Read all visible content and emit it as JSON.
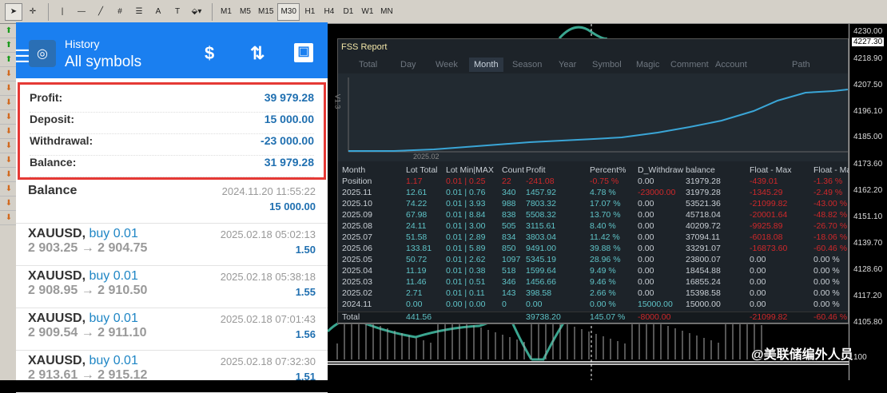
{
  "toolbar": {
    "timeframes": [
      "M1",
      "M5",
      "M15",
      "M30",
      "H1",
      "H4",
      "D1",
      "W1",
      "MN"
    ],
    "active": "M30",
    "tools": [
      "A"
    ]
  },
  "mobile": {
    "title": "History",
    "subtitle": "All symbols",
    "menu_icon": "☰",
    "icons": [
      "deposit-swap-icon",
      "sort-icon",
      "calendar-icon"
    ],
    "summary": [
      {
        "label": "Profit:",
        "value": "39 979.28"
      },
      {
        "label": "Deposit:",
        "value": "15 000.00"
      },
      {
        "label": "Withdrawal:",
        "value": "-23 000.00"
      },
      {
        "label": "Balance:",
        "value": "31 979.28"
      }
    ],
    "balance_item": {
      "title": "Balance",
      "date": "2024.11.20 11:55:22",
      "value": "15 000.00"
    },
    "trades": [
      {
        "symbol": "XAUUSD,",
        "side": "buy 0.01",
        "prices": "2 903.25 → 2 904.75",
        "date": "2025.02.18 05:02:13",
        "profit": "1.50"
      },
      {
        "symbol": "XAUUSD,",
        "side": "buy 0.01",
        "prices": "2 908.95 → 2 910.50",
        "date": "2025.02.18 05:38:18",
        "profit": "1.55"
      },
      {
        "symbol": "XAUUSD,",
        "side": "buy 0.01",
        "prices": "2 909.54 → 2 911.10",
        "date": "2025.02.18 07:01:43",
        "profit": "1.56"
      },
      {
        "symbol": "XAUUSD,",
        "side": "buy 0.01",
        "prices": "2 913.61 → 2 915.12",
        "date": "2025.02.18 07:32:30",
        "profit": "1.51"
      }
    ]
  },
  "report": {
    "title": "FSS Report",
    "tabs": [
      "Total",
      "Day",
      "Week",
      "Month",
      "Season",
      "Year",
      "Symbol",
      "Magic",
      "Comment",
      "Account",
      "Path"
    ],
    "active_tab": "Month",
    "graph_label": "2025.02",
    "side_label": "V1.3",
    "headers": [
      "Month",
      "Lot Total",
      "Lot Min|MAX",
      "Count",
      "Profit",
      "Percent%",
      "D_Withdraw",
      "balance",
      "Float - Max",
      "Float - Ma"
    ],
    "rows": [
      [
        "Position",
        "1.17",
        "0.01 | 0.25",
        "22",
        "-241.08",
        "-0.75 %",
        "0.00",
        "31979.28",
        "-439.01",
        "-1.36 %"
      ],
      [
        "2025.11",
        "12.61",
        "0.01 | 0.76",
        "340",
        "1457.92",
        "4.78 %",
        "-23000.00",
        "31979.28",
        "-1345.29",
        "-2.49 %"
      ],
      [
        "2025.10",
        "74.22",
        "0.01 | 3.93",
        "988",
        "7803.32",
        "17.07 %",
        "0.00",
        "53521.36",
        "-21099.82",
        "-43.00 %"
      ],
      [
        "2025.09",
        "67.98",
        "0.01 | 8.84",
        "838",
        "5508.32",
        "13.70 %",
        "0.00",
        "45718.04",
        "-20001.64",
        "-48.82 %"
      ],
      [
        "2025.08",
        "24.11",
        "0.01 | 3.00",
        "505",
        "3115.61",
        "8.40 %",
        "0.00",
        "40209.72",
        "-9925.89",
        "-26.70 %"
      ],
      [
        "2025.07",
        "51.58",
        "0.01 | 2.89",
        "834",
        "3803.04",
        "11.42 %",
        "0.00",
        "37094.11",
        "-6018.08",
        "-18.06 %"
      ],
      [
        "2025.06",
        "133.81",
        "0.01 | 5.89",
        "850",
        "9491.00",
        "39.88 %",
        "0.00",
        "33291.07",
        "-16873.60",
        "-60.46 %"
      ],
      [
        "2025.05",
        "50.72",
        "0.01 | 2.62",
        "1097",
        "5345.19",
        "28.96 %",
        "0.00",
        "23800.07",
        "0.00",
        "0.00 %"
      ],
      [
        "2025.04",
        "11.19",
        "0.01 | 0.38",
        "518",
        "1599.64",
        "9.49 %",
        "0.00",
        "18454.88",
        "0.00",
        "0.00 %"
      ],
      [
        "2025.03",
        "11.46",
        "0.01 | 0.51",
        "346",
        "1456.66",
        "9.46 %",
        "0.00",
        "16855.24",
        "0.00",
        "0.00 %"
      ],
      [
        "2025.02",
        "2.71",
        "0.01 | 0.11",
        "143",
        "398.58",
        "2.66 %",
        "0.00",
        "15398.58",
        "0.00",
        "0.00 %"
      ],
      [
        "2024.11",
        "0.00",
        "0.00 | 0.00",
        "0",
        "0.00",
        "0.00 %",
        "15000.00",
        "15000.00",
        "0.00",
        "0.00 %"
      ]
    ],
    "total": [
      "Total",
      "441.56",
      "",
      "",
      "39738.20",
      "145.07 %",
      "-8000.00",
      "",
      "-21099.82",
      "-60.46 %"
    ]
  },
  "axis": {
    "current": "4227.30",
    "labels": [
      "4230.00",
      "4218.90",
      "4207.50",
      "4196.10",
      "4185.00",
      "4173.60",
      "4162.20",
      "4151.10",
      "4139.70",
      "4128.60",
      "4117.20",
      "4105.80",
      "100"
    ]
  },
  "watermark": "@美联储编外人员",
  "colors": {
    "mobile_header": "#1a7ff0",
    "highlight_box": "#e53935",
    "cyan": "#5fc4c8",
    "red": "#d0282a"
  }
}
